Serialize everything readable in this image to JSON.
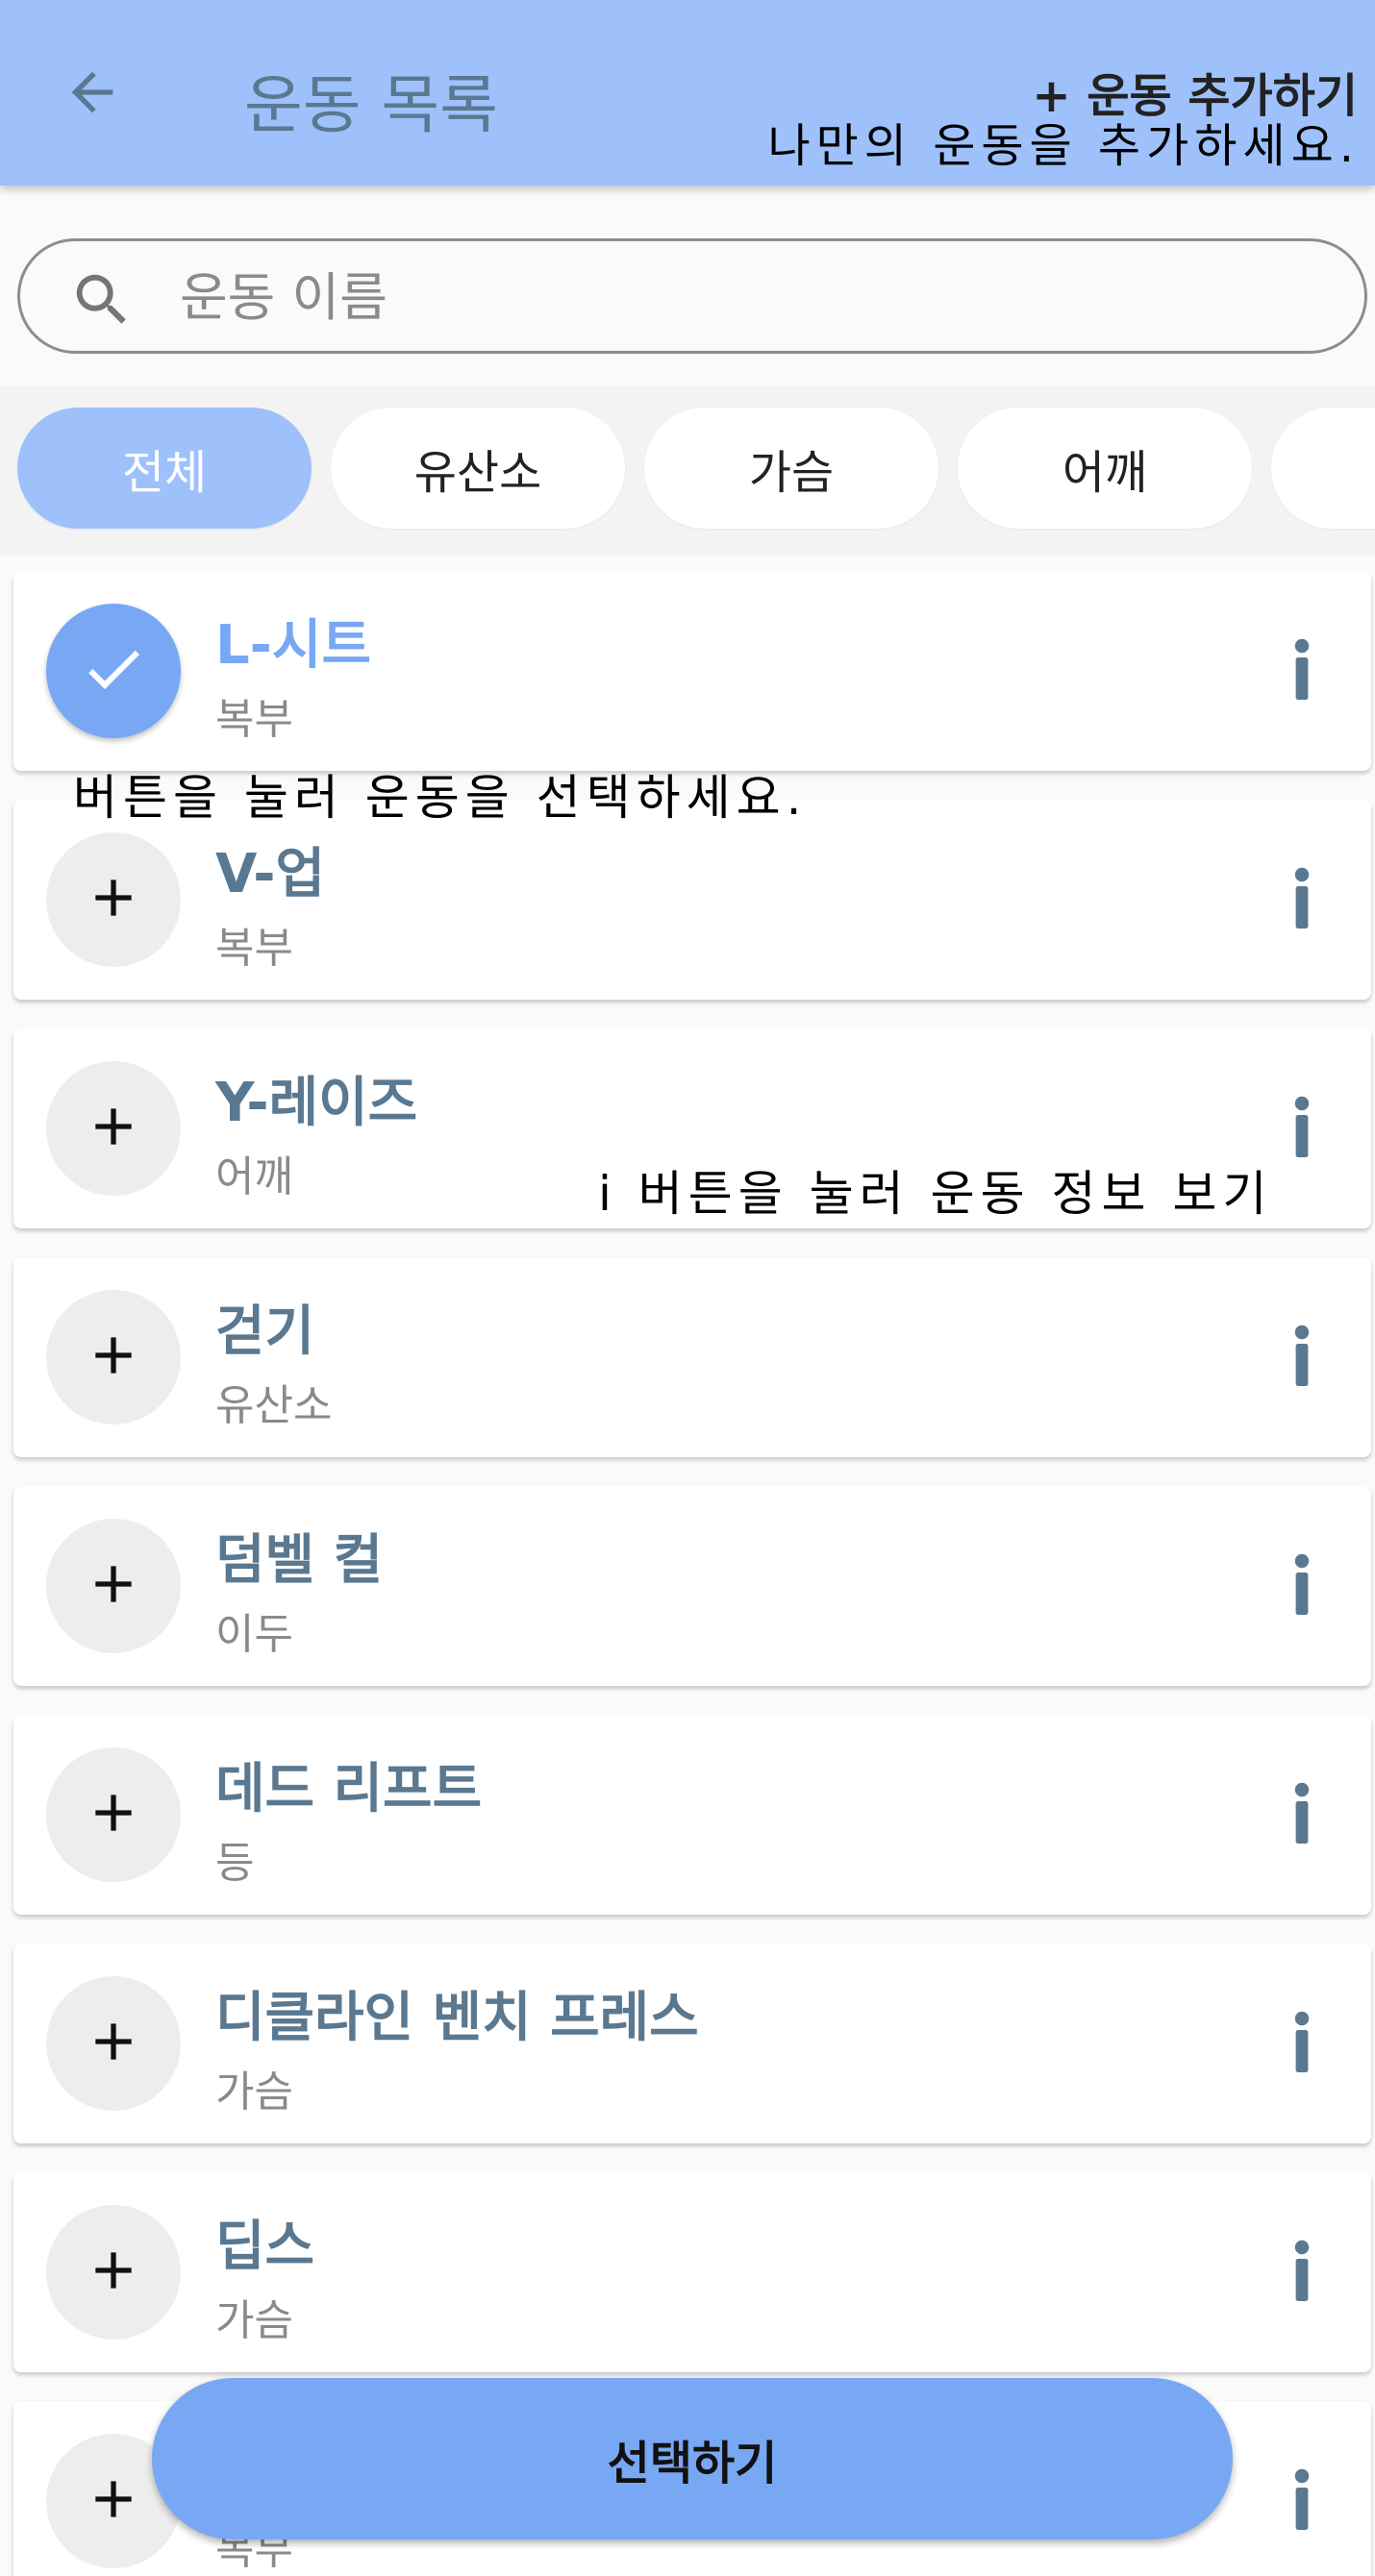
{
  "appbar": {
    "back_icon": "arrow-left-icon",
    "title": "운동 목록",
    "add_button_label": "+ 운동 추가하기",
    "add_hint": "나만의 운동을 추가하세요."
  },
  "search": {
    "icon": "search-icon",
    "placeholder": "운동 이름"
  },
  "filters": [
    "전체",
    "유산소",
    "가슴",
    "어깨"
  ],
  "selected_filter": "전체",
  "exercises": [
    {
      "name": "L-시트",
      "category": "복부",
      "selected": true
    },
    {
      "name": "V-업",
      "category": "복부",
      "selected": false
    },
    {
      "name": "Y-레이즈",
      "category": "어깨",
      "selected": false
    },
    {
      "name": "걷기",
      "category": "유산소",
      "selected": false
    },
    {
      "name": "덤벨 컬",
      "category": "이두",
      "selected": false
    },
    {
      "name": "데드 리프트",
      "category": "등",
      "selected": false
    },
    {
      "name": "디클라인 벤치 프레스",
      "category": "가슴",
      "selected": false
    },
    {
      "name": "딥스",
      "category": "가슴",
      "selected": false
    },
    {
      "name": "",
      "category": "복부",
      "selected": false
    }
  ],
  "hints": {
    "select": "버튼을 눌러 운동을 선택하세요.",
    "info": "i 버튼을 눌러 운동 정보 보기"
  },
  "info_button_label": "i",
  "bottom_button_label": "선택하기",
  "colors": {
    "appbar": "#9ec1fc",
    "accent": "#78a8f4",
    "name_text": "#5a7890"
  }
}
